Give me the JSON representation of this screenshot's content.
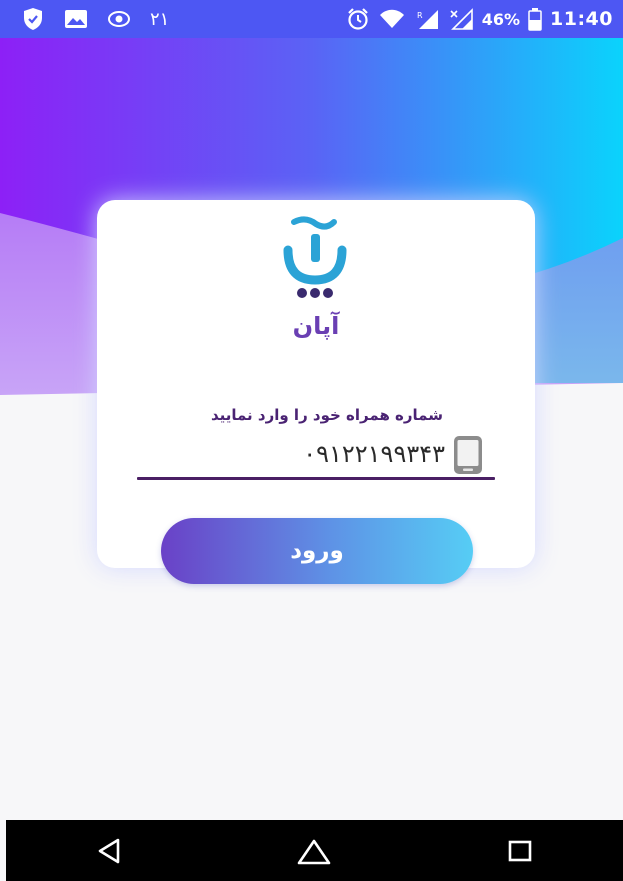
{
  "status_bar": {
    "left_digits": "۲۱",
    "battery_percent": "46%",
    "clock": "11:40",
    "icons_left": [
      "shield-icon",
      "image-icon",
      "eye-icon"
    ],
    "icons_right": [
      "alarm-icon",
      "wifi-icon",
      "signal-r-icon",
      "signal-x-icon",
      "battery-icon"
    ]
  },
  "app": {
    "brand_name": "آپان",
    "logo_icon": "apan-logo-icon"
  },
  "login": {
    "phone_label": "شماره همراه خود را وارد نمایید",
    "phone_value": "۰۹۱۲۲۱۹۹۳۴۳",
    "phone_icon": "mobile-phone-icon",
    "submit_label": "ورود"
  },
  "nav_bar": {
    "icons": [
      "back-icon",
      "home-icon",
      "recents-icon"
    ]
  },
  "colors": {
    "status_bar": "#4d57f3",
    "gradient_start": "#8d20f6",
    "gradient_end": "#0ad3fc",
    "brand_purple": "#6a3fb3",
    "label_purple": "#4a2373",
    "underline": "#4a1f64",
    "button_start": "#6a41c7",
    "button_end": "#56cdf5"
  }
}
